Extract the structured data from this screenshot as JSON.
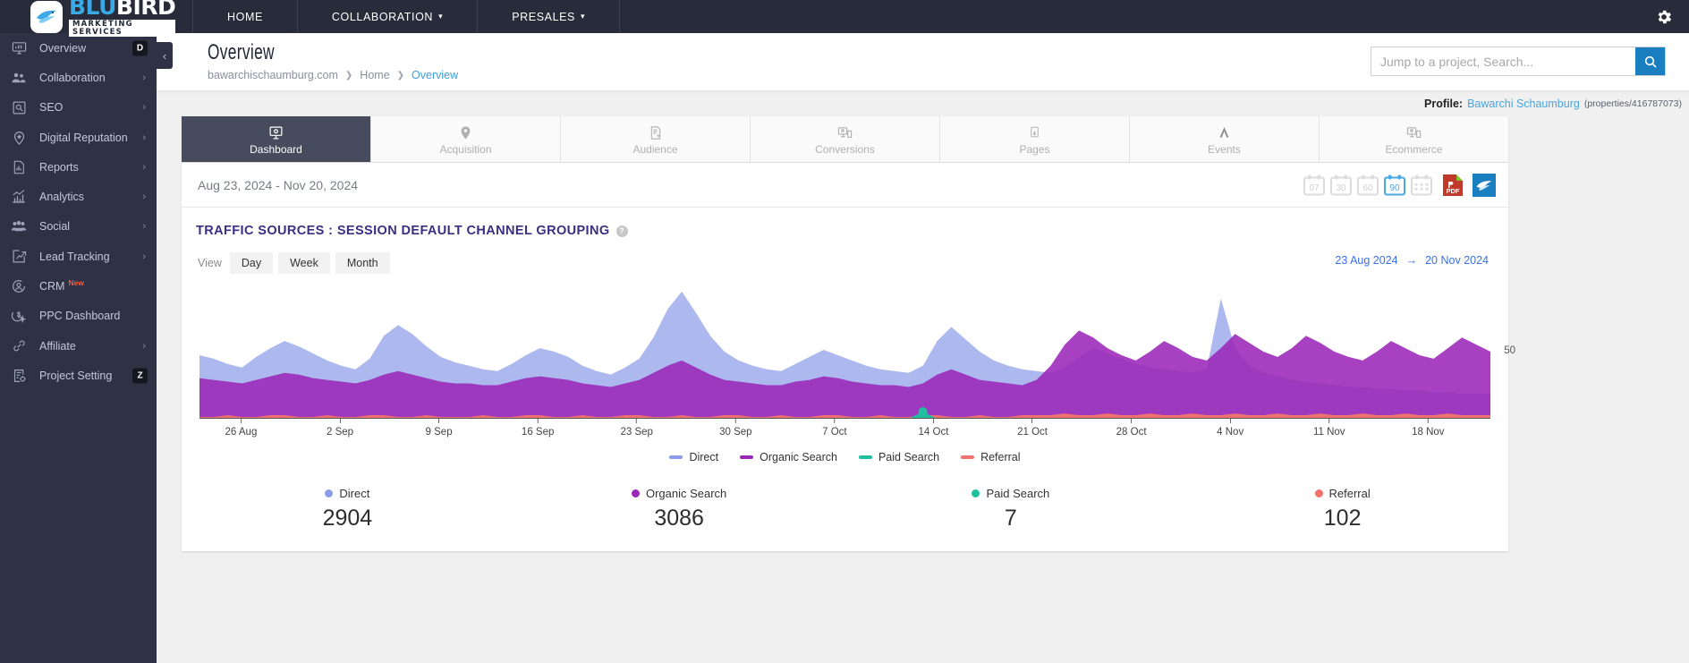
{
  "topbar": {
    "logo": {
      "primary": "BLU",
      "secondary": "BIRD",
      "tagline": "MARKETING SERVICES"
    },
    "nav": [
      {
        "label": "HOME",
        "caret": false
      },
      {
        "label": "COLLABORATION",
        "caret": true
      },
      {
        "label": "PRESALES",
        "caret": true
      }
    ],
    "settings_icon": "gear-icon"
  },
  "sidebar": {
    "items": [
      {
        "label": "Overview",
        "icon": "monitor-chart-icon",
        "chevron": false,
        "key": "D"
      },
      {
        "label": "Collaboration",
        "icon": "people-icon",
        "chevron": true,
        "key": ""
      },
      {
        "label": "SEO",
        "icon": "magnify-box-icon",
        "chevron": true,
        "key": ""
      },
      {
        "label": "Digital Reputation",
        "icon": "pin-star-icon",
        "chevron": true,
        "key": ""
      },
      {
        "label": "Reports",
        "icon": "document-chart-icon",
        "chevron": true,
        "key": ""
      },
      {
        "label": "Analytics",
        "icon": "trend-up-icon",
        "chevron": true,
        "key": ""
      },
      {
        "label": "Social",
        "icon": "group-icon",
        "chevron": true,
        "key": ""
      },
      {
        "label": "Lead Tracking",
        "icon": "clipboard-arrow-icon",
        "chevron": true,
        "key": ""
      },
      {
        "label": "CRM",
        "icon": "user-circle-icon",
        "chevron": false,
        "key": "",
        "badge": "New"
      },
      {
        "label": "PPC Dashboard",
        "icon": "dollar-cursor-icon",
        "chevron": false,
        "key": ""
      },
      {
        "label": "Affiliate",
        "icon": "link-icon",
        "chevron": true,
        "key": ""
      },
      {
        "label": "Project Setting",
        "icon": "clipboard-gear-icon",
        "chevron": false,
        "key": "Z"
      }
    ],
    "collapse_icon": "chevron-left-icon"
  },
  "header": {
    "title": "Overview",
    "breadcrumb": [
      {
        "label": "bawarchischaumburg.com",
        "current": false
      },
      {
        "label": "Home",
        "current": false
      },
      {
        "label": "Overview",
        "current": true
      }
    ],
    "search": {
      "placeholder": "Jump to a project, Search...",
      "value": "",
      "icon": "search-icon"
    }
  },
  "profile": {
    "label": "Profile:",
    "name": "Bawarchi Schaumburg",
    "id": "(properties/416787073)"
  },
  "tabs": [
    {
      "label": "Dashboard",
      "icon": "monitor-target-icon",
      "active": true
    },
    {
      "label": "Acquisition",
      "icon": "map-pin-person-icon",
      "active": false
    },
    {
      "label": "Audience",
      "icon": "document-cursor-icon",
      "active": false
    },
    {
      "label": "Conversions",
      "icon": "monitor-mobile-icon",
      "active": false
    },
    {
      "label": "Pages",
      "icon": "page-click-icon",
      "active": false
    },
    {
      "label": "Events",
      "icon": "lambda-icon",
      "active": false
    },
    {
      "label": "Ecommerce",
      "icon": "monitor-cart-icon",
      "active": false
    }
  ],
  "daterow": {
    "range_text": "Aug 23, 2024 - Nov 20, 2024",
    "presets": [
      {
        "label": "07",
        "active": false
      },
      {
        "label": "30",
        "active": false
      },
      {
        "label": "60",
        "active": false
      },
      {
        "label": "90",
        "active": true
      }
    ],
    "calendar_picker_icon": "calendar-icon",
    "pdf_label": "PDF",
    "pdf_icon": "pdf-export-icon",
    "share_icon": "blubird-logo-icon"
  },
  "panel": {
    "title": "TRAFFIC SOURCES : SESSION DEFAULT CHANNEL GROUPING",
    "help_icon": "question-mark-icon",
    "view_label": "View",
    "view_options": [
      {
        "label": "Day",
        "active": true
      },
      {
        "label": "Week",
        "active": false
      },
      {
        "label": "Month",
        "active": false
      }
    ],
    "range_start": "23 Aug 2024",
    "range_arrow": "→",
    "range_end": "20 Nov 2024"
  },
  "metrics": [
    {
      "label": "Direct",
      "value": "2904",
      "color": "#8c9ce8"
    },
    {
      "label": "Organic Search",
      "value": "3086",
      "color": "#9b27b8"
    },
    {
      "label": "Paid Search",
      "value": "7",
      "color": "#1fbfa0"
    },
    {
      "label": "Referral",
      "value": "102",
      "color": "#f4726c"
    }
  ],
  "chart_data": {
    "type": "area",
    "title": "TRAFFIC SOURCES : SESSION DEFAULT CHANNEL GROUPING",
    "xlabel": "",
    "ylabel": "",
    "ylim": [
      0,
      75
    ],
    "ytick_labels": [
      "50"
    ],
    "ytick_values": [
      50
    ],
    "grid": false,
    "legend_position": "bottom",
    "stacked": false,
    "x_tick_labels": [
      "26 Aug",
      "2 Sep",
      "9 Sep",
      "16 Sep",
      "23 Sep",
      "30 Sep",
      "7 Oct",
      "14 Oct",
      "21 Oct",
      "28 Oct",
      "4 Nov",
      "11 Nov",
      "18 Nov"
    ],
    "x_range": [
      "23 Aug 2024",
      "20 Nov 2024"
    ],
    "series": [
      {
        "name": "Direct",
        "color": "#8c9ce8",
        "total": 2904,
        "values": [
          36,
          34,
          31,
          29,
          35,
          40,
          44,
          41,
          37,
          33,
          30,
          28,
          34,
          47,
          53,
          48,
          41,
          35,
          32,
          30,
          28,
          27,
          31,
          36,
          40,
          38,
          35,
          30,
          27,
          25,
          29,
          34,
          46,
          62,
          72,
          60,
          47,
          38,
          33,
          30,
          28,
          27,
          31,
          35,
          39,
          36,
          33,
          30,
          28,
          27,
          26,
          30,
          44,
          52,
          45,
          38,
          33,
          30,
          28,
          27,
          26,
          29,
          35,
          40,
          37,
          34,
          31,
          29,
          28,
          27,
          26,
          28,
          68,
          40,
          30,
          26,
          24,
          22,
          21,
          20,
          19,
          18,
          18,
          17,
          17,
          16,
          16,
          15,
          15,
          14,
          14,
          14
        ]
      },
      {
        "name": "Organic Search",
        "color": "#9b27b8",
        "total": 3086,
        "values": [
          23,
          22,
          21,
          20,
          22,
          24,
          26,
          25,
          23,
          22,
          21,
          20,
          22,
          25,
          27,
          25,
          23,
          21,
          20,
          20,
          19,
          19,
          21,
          23,
          24,
          23,
          22,
          20,
          19,
          18,
          20,
          22,
          26,
          30,
          33,
          29,
          25,
          22,
          21,
          20,
          19,
          19,
          21,
          22,
          24,
          23,
          21,
          20,
          19,
          19,
          18,
          20,
          25,
          28,
          25,
          22,
          21,
          20,
          19,
          22,
          30,
          42,
          50,
          46,
          40,
          36,
          33,
          38,
          44,
          40,
          35,
          33,
          40,
          48,
          43,
          38,
          35,
          40,
          47,
          43,
          38,
          35,
          33,
          38,
          44,
          40,
          36,
          34,
          40,
          46,
          42,
          38
        ]
      },
      {
        "name": "Paid Search",
        "color": "#1fbfa0",
        "total": 7,
        "values": [
          0,
          0,
          0,
          0,
          0,
          0,
          0,
          0,
          0,
          0,
          0,
          0,
          0,
          0,
          0,
          0,
          0,
          0,
          0,
          0,
          0,
          0,
          0,
          0,
          0,
          0,
          0,
          0,
          0,
          0,
          0,
          0,
          0,
          0,
          0,
          0,
          0,
          0,
          0,
          0,
          0,
          0,
          0,
          0,
          0,
          0,
          0,
          0,
          0,
          0,
          0,
          4,
          0,
          0,
          0,
          0,
          0,
          0,
          0,
          0,
          0,
          0,
          0,
          0,
          0,
          0,
          0,
          0,
          0,
          0,
          0,
          0,
          0,
          0,
          0,
          0,
          0,
          0,
          0,
          0,
          0,
          0,
          0,
          0,
          0,
          0,
          0,
          0,
          0,
          0,
          0,
          0
        ]
      },
      {
        "name": "Referral",
        "color": "#f4726c",
        "total": 102,
        "values": [
          1,
          1,
          2,
          1,
          1,
          2,
          2,
          1,
          1,
          2,
          1,
          1,
          2,
          2,
          1,
          1,
          2,
          1,
          1,
          1,
          2,
          1,
          1,
          2,
          2,
          1,
          1,
          2,
          1,
          1,
          2,
          2,
          1,
          1,
          2,
          1,
          1,
          2,
          2,
          1,
          1,
          2,
          1,
          1,
          2,
          2,
          1,
          1,
          2,
          1,
          1,
          2,
          2,
          1,
          1,
          2,
          1,
          1,
          2,
          2,
          2,
          3,
          2,
          2,
          3,
          2,
          2,
          3,
          2,
          2,
          3,
          2,
          2,
          3,
          2,
          2,
          3,
          2,
          2,
          3,
          2,
          2,
          3,
          2,
          2,
          3,
          2,
          2,
          3,
          2,
          2,
          2
        ]
      }
    ]
  }
}
